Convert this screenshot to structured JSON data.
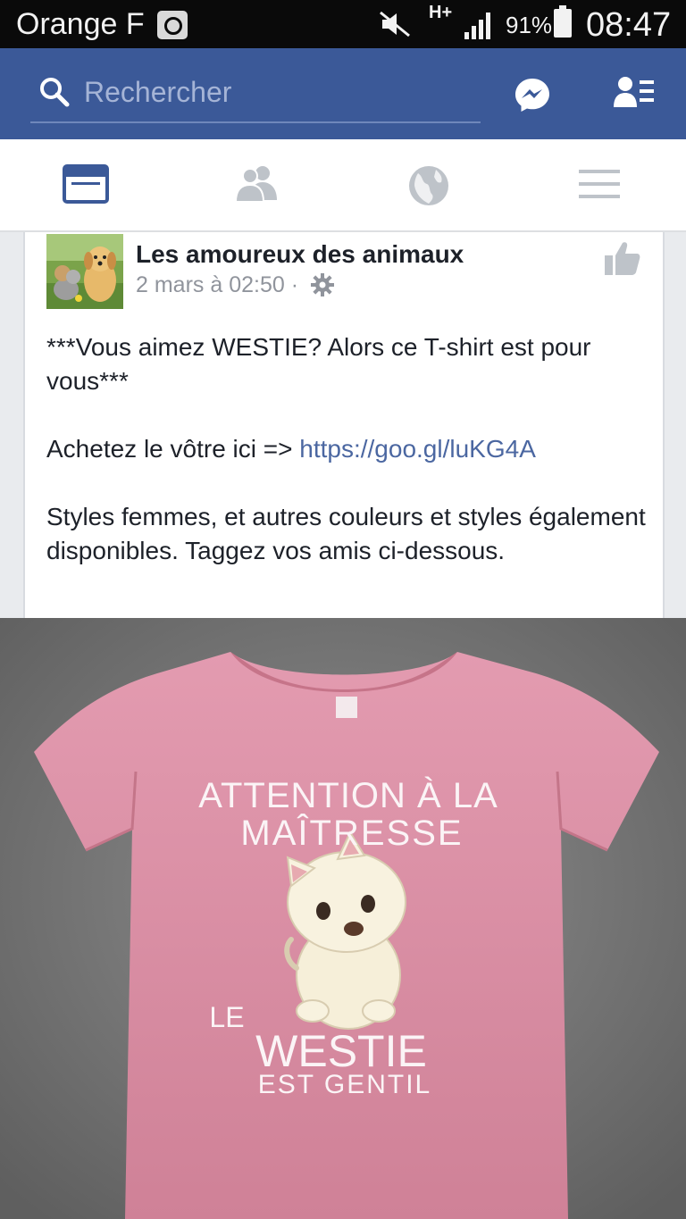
{
  "status_bar": {
    "carrier": "Orange F",
    "network": "H+",
    "battery": "91%",
    "time": "08:47"
  },
  "header": {
    "search_placeholder": "Rechercher"
  },
  "tabs": [
    {
      "name": "news-feed",
      "active": true
    },
    {
      "name": "friends",
      "active": false
    },
    {
      "name": "notifications",
      "active": false
    },
    {
      "name": "menu",
      "active": false
    }
  ],
  "post": {
    "page_name": "Les amoureux des animaux",
    "date": "2 mars à 02:50",
    "separator": "·",
    "text_line1": "***Vous aimez WESTIE? Alors ce T-shirt est pour vous***",
    "text_line2_prefix": "Achetez le vôtre ici => ",
    "link": "https://goo.gl/luKG4A",
    "text_line3": "Styles femmes, et autres couleurs et styles également disponibles. Taggez vos amis ci-dessous."
  },
  "shirt": {
    "line1": "ATTENTION À LA",
    "line2": "MAÎTRESSE",
    "line3": "LE",
    "line4": "WESTIE",
    "line5": "EST GENTIL"
  },
  "colors": {
    "facebook_blue": "#3b5998",
    "link_blue": "#4b67a1",
    "shirt_pink": "#d98da0"
  }
}
